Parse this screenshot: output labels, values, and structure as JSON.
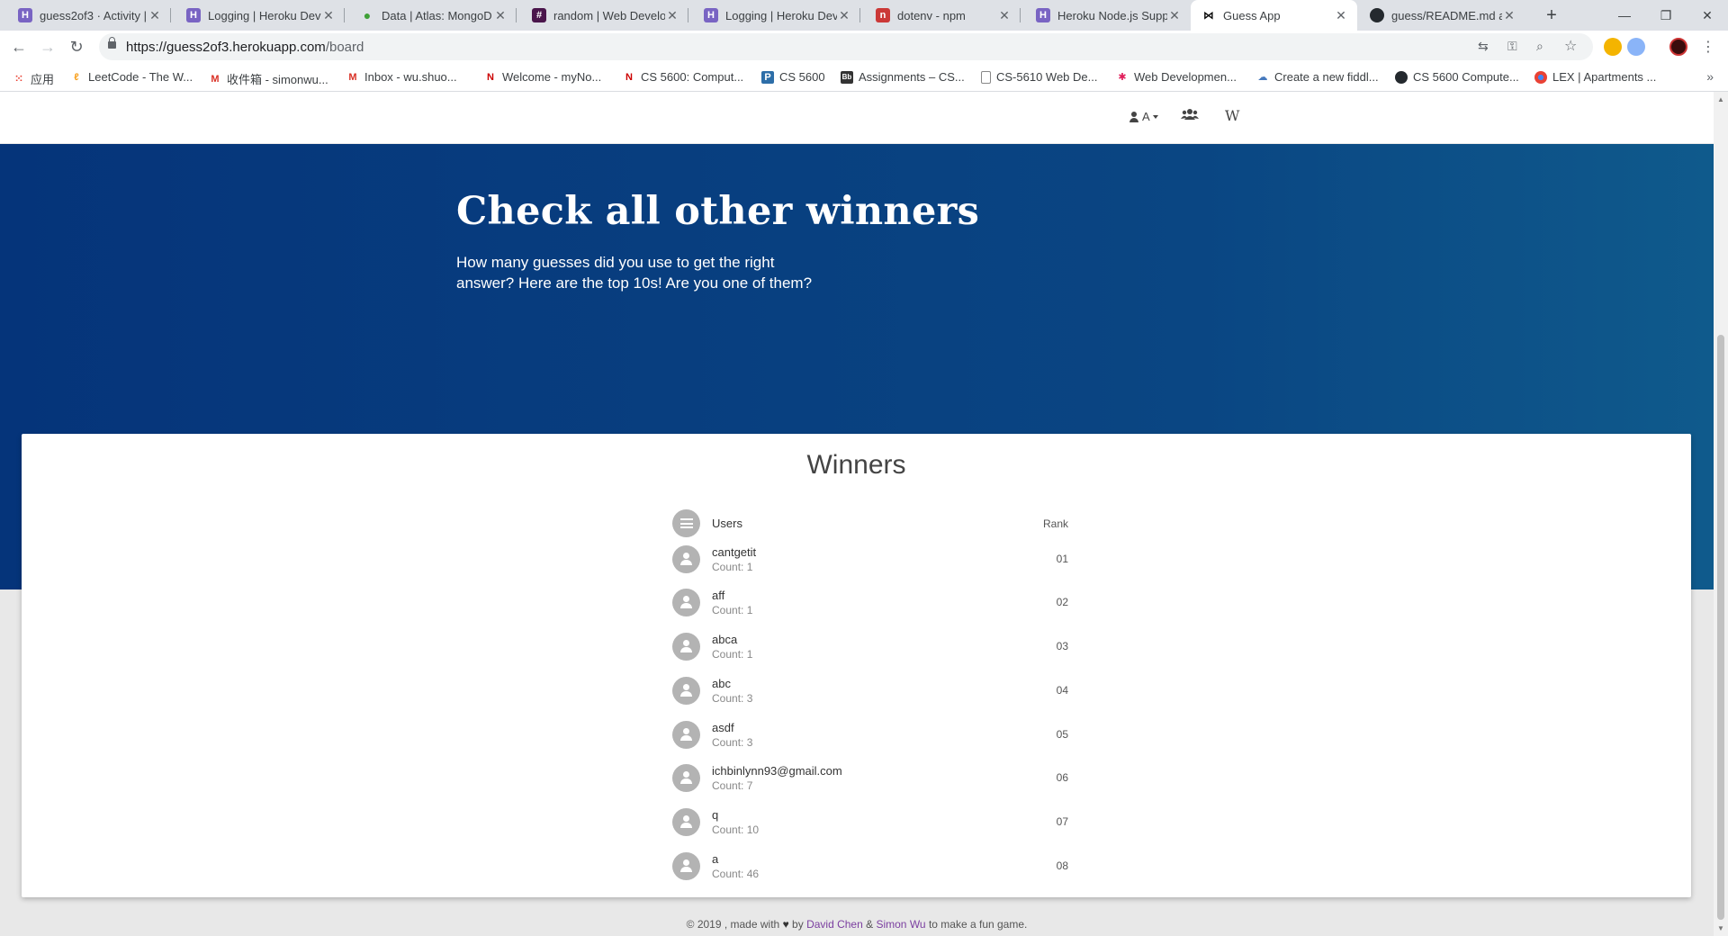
{
  "browser": {
    "tabs": [
      {
        "title": "guess2of3 · Activity |",
        "favicon": "H",
        "color": "#7964c3"
      },
      {
        "title": "Logging | Heroku Dev",
        "favicon": "H",
        "color": "#7964c3"
      },
      {
        "title": "Data | Atlas: MongoD",
        "favicon": "",
        "color": "#3fa037"
      },
      {
        "title": "random | Web Develo",
        "favicon": "#",
        "color": "#4a154b"
      },
      {
        "title": "Logging | Heroku Dev",
        "favicon": "H",
        "color": "#7964c3"
      },
      {
        "title": "dotenv - npm",
        "favicon": "n",
        "color": "#cb3837"
      },
      {
        "title": "Heroku Node.js Supp",
        "favicon": "H",
        "color": "#7964c3"
      },
      {
        "title": "Guess App",
        "favicon": "",
        "color": "#000000"
      },
      {
        "title": "guess/README.md a",
        "favicon": "",
        "color": "#24292e"
      }
    ],
    "url_host": "https://guess2of3.herokuapp.com",
    "url_path": "/board",
    "bookmarks": [
      {
        "label": "应用",
        "color": "#ea4335"
      },
      {
        "label": "LeetCode - The W...",
        "color": "#f89f1b"
      },
      {
        "label": "收件箱 - simonwu...",
        "color": "#d93025"
      },
      {
        "label": "Inbox - wu.shuo...",
        "color": "#d93025"
      },
      {
        "label": "Welcome - myNo...",
        "color": "#cc0000"
      },
      {
        "label": "CS 5600: Comput...",
        "color": "#cc0000"
      },
      {
        "label": "CS 5600",
        "color": "#2d6ea8"
      },
      {
        "label": "Assignments – CS...",
        "color": "#333333"
      },
      {
        "label": "CS-5610 Web De...",
        "color": "#888888"
      },
      {
        "label": "Web Developmen...",
        "color": "#e01e5a"
      },
      {
        "label": "Create a new fiddl...",
        "color": "#4679bd"
      },
      {
        "label": "CS 5600 Compute...",
        "color": "#24292e"
      },
      {
        "label": "LEX | Apartments ...",
        "color": "#e94235"
      }
    ],
    "bookmarks_overflow": "»"
  },
  "site_nav": {
    "user_label": "A",
    "wiki_label": "W"
  },
  "hero": {
    "title": "Check all other winners",
    "subtitle": "How many guesses did you use to get the right answer? Here are the top 10s! Are you one of them?"
  },
  "board": {
    "title": "Winners",
    "header_users": "Users",
    "header_rank": "Rank",
    "rows": [
      {
        "name": "cantgetit",
        "count": "Count: 1",
        "rank": "01"
      },
      {
        "name": "aff",
        "count": "Count: 1",
        "rank": "02"
      },
      {
        "name": "abca",
        "count": "Count: 1",
        "rank": "03"
      },
      {
        "name": "abc",
        "count": "Count: 3",
        "rank": "04"
      },
      {
        "name": "asdf",
        "count": "Count: 3",
        "rank": "05"
      },
      {
        "name": "ichbinlynn93@gmail.com",
        "count": "Count: 7",
        "rank": "06"
      },
      {
        "name": "q",
        "count": "Count: 10",
        "rank": "07"
      },
      {
        "name": "a",
        "count": "Count: 46",
        "rank": "08"
      }
    ]
  },
  "footer": {
    "prefix": "© 2019 , made with",
    "by": "by",
    "author1": "David Chen",
    "amp": "&",
    "author2": "Simon Wu",
    "suffix": "to make a fun game."
  }
}
